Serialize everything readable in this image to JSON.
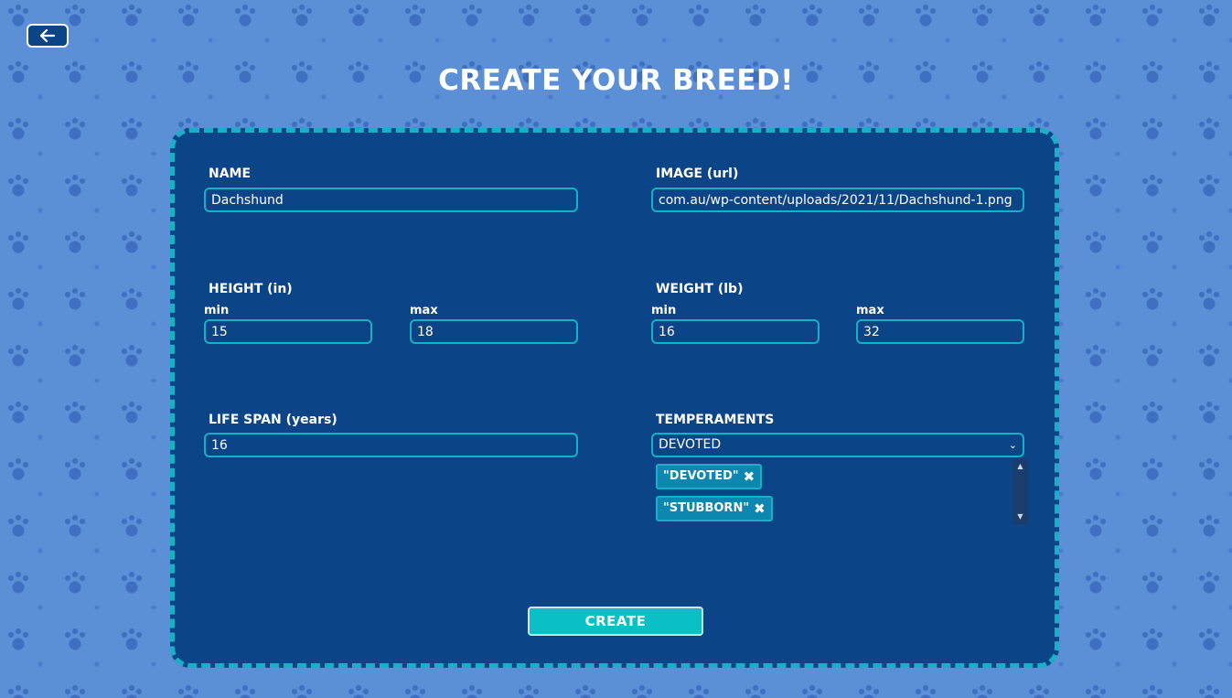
{
  "page": {
    "title": "CREATE YOUR BREED!"
  },
  "colors": {
    "background": "#5b8fd6",
    "card": "#0c4488",
    "accent": "#18b0c6",
    "button": "#0bbfc6"
  },
  "back_button": {
    "icon": "arrow-left-icon"
  },
  "form": {
    "name": {
      "label": "NAME",
      "value": "Dachshund"
    },
    "image": {
      "label": "IMAGE (url)",
      "value": "com.au/wp-content/uploads/2021/11/Dachshund-1.png"
    },
    "height": {
      "label": "HEIGHT (in)",
      "min_label": "min",
      "max_label": "max",
      "min": "15",
      "max": "18"
    },
    "weight": {
      "label": "WEIGHT (lb)",
      "min_label": "min",
      "max_label": "max",
      "min": "16",
      "max": "32"
    },
    "life_span": {
      "label": "LIFE SPAN (years)",
      "value": "16"
    },
    "temperaments": {
      "label": "TEMPERAMENTS",
      "selected": "DEVOTED",
      "tags": [
        "\"DEVOTED\"",
        "\"STUBBORN\""
      ]
    },
    "create_label": "CREATE"
  }
}
